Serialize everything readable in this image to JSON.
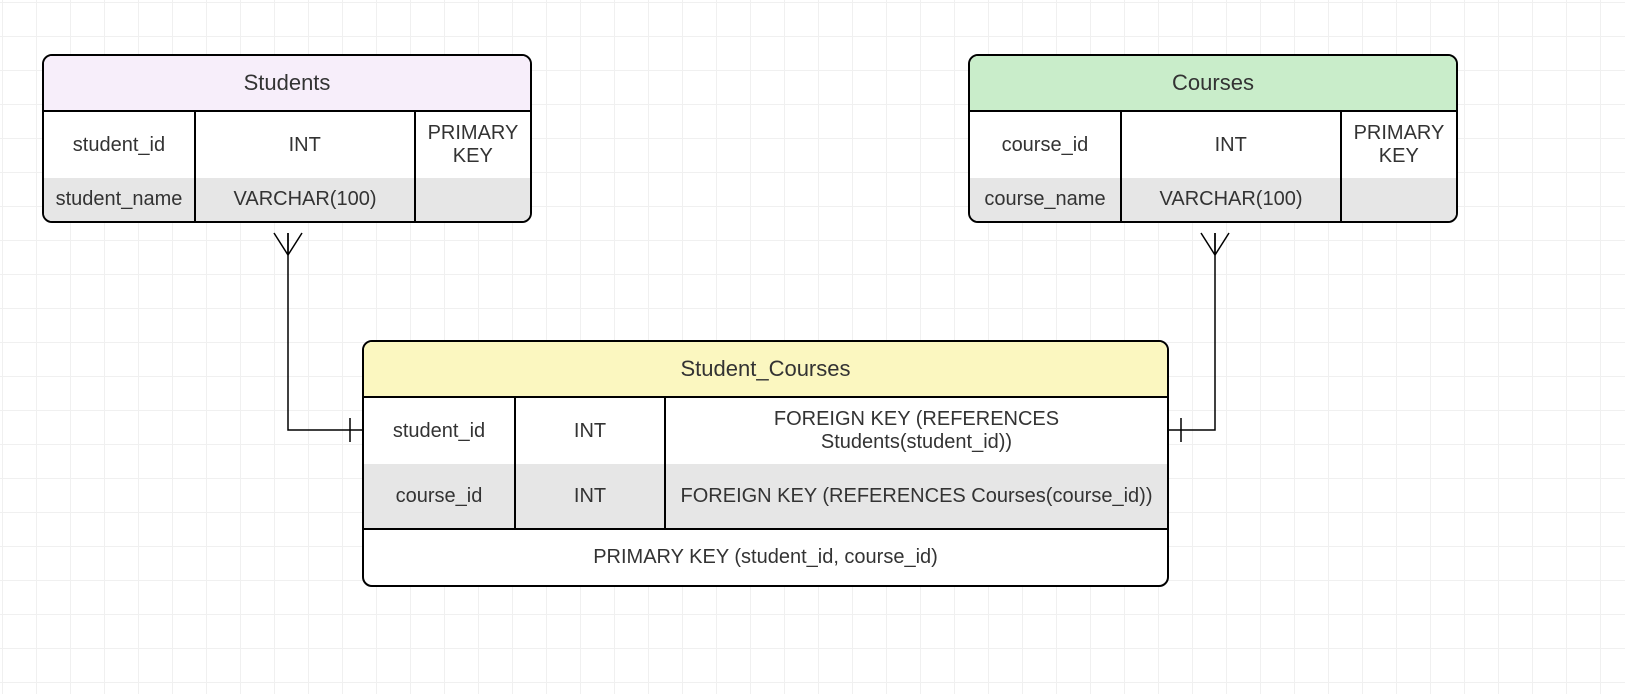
{
  "entities": {
    "students": {
      "title": "Students",
      "rows": [
        {
          "name": "student_id",
          "type": "INT",
          "key": "PRIMARY KEY"
        },
        {
          "name": "student_name",
          "type": "VARCHAR(100)",
          "key": ""
        }
      ]
    },
    "courses": {
      "title": "Courses",
      "rows": [
        {
          "name": "course_id",
          "type": "INT",
          "key": "PRIMARY KEY"
        },
        {
          "name": "course_name",
          "type": "VARCHAR(100)",
          "key": ""
        }
      ]
    },
    "student_courses": {
      "title": "Student_Courses",
      "rows": [
        {
          "name": "student_id",
          "type": "INT",
          "key": "FOREIGN KEY (REFERENCES Students(student_id))"
        },
        {
          "name": "course_id",
          "type": "INT",
          "key": "FOREIGN KEY (REFERENCES Courses(course_id))"
        }
      ],
      "footer": "PRIMARY KEY (student_id, course_id)"
    }
  },
  "relationships": [
    {
      "from": "students",
      "to": "student_courses",
      "from_cardinality": "many",
      "to_cardinality": "one"
    },
    {
      "from": "courses",
      "to": "student_courses",
      "from_cardinality": "many",
      "to_cardinality": "one"
    }
  ]
}
